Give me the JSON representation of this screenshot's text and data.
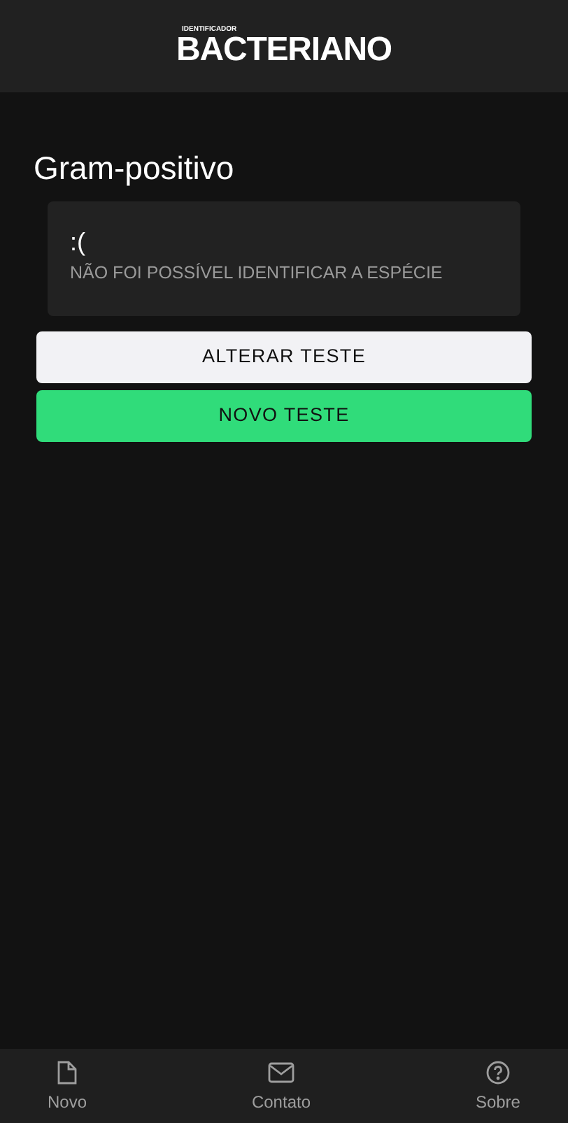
{
  "header": {
    "logo_small": "IDENTIFICADOR",
    "logo": "BACTERIANO"
  },
  "title": "Gram-positivo",
  "result": {
    "face": ":(",
    "message": "NÃO FOI POSSÍVEL IDENTIFICAR A ESPÉCIE"
  },
  "buttons": [
    {
      "label": "ALTERAR TESTE",
      "kind": "secondary"
    },
    {
      "label": "NOVO TESTE",
      "kind": "primary"
    }
  ],
  "nav": [
    {
      "label": "Novo",
      "kind": "file"
    },
    {
      "label": "Contato",
      "kind": "mail"
    },
    {
      "label": "Sobre",
      "kind": "help"
    }
  ]
}
